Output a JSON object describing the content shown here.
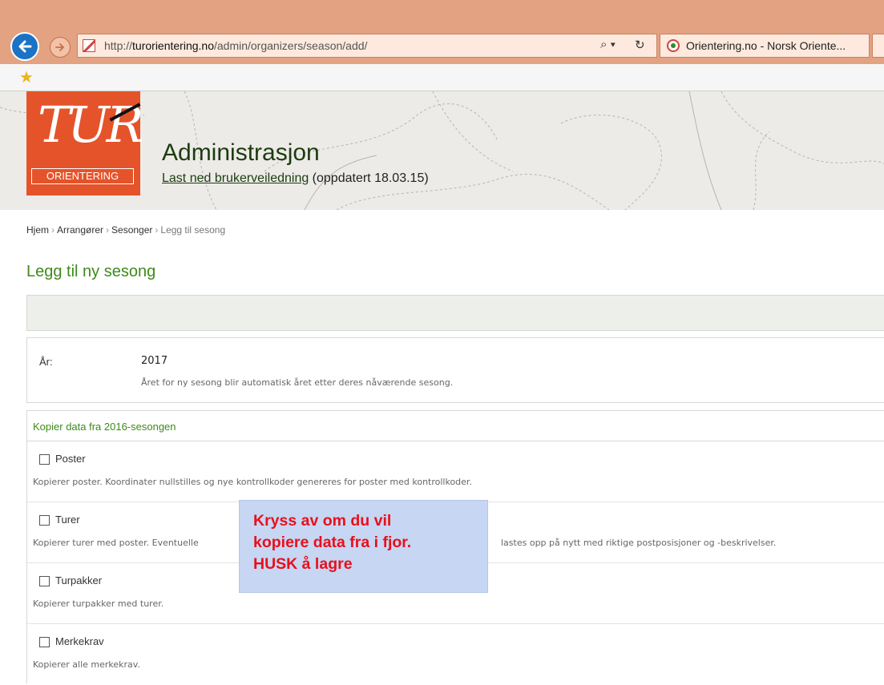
{
  "browser": {
    "url_prefix": "http://",
    "url_host": "turorientering.no",
    "url_path": "/admin/organizers/season/add/",
    "search_glyph": "⌕ ▾",
    "refresh_glyph": "↻",
    "tab_title": "Orientering.no - Norsk Oriente...",
    "icons": [
      "back-arrow-icon",
      "forward-arrow-icon",
      "site-favicon-icon",
      "search-icon",
      "refresh-icon",
      "favorites-star-icon"
    ]
  },
  "header": {
    "logo_main": "TUR",
    "logo_sub": "ORIENTERING",
    "title": "Administrasjon",
    "manual_link": "Last ned brukerveiledning",
    "manual_note": " (oppdatert 18.03.15)"
  },
  "breadcrumb": {
    "items": [
      "Hjem",
      "Arrangører",
      "Sesonger"
    ],
    "current": "Legg til sesong",
    "separator": "›"
  },
  "page": {
    "title": "Legg til ny sesong"
  },
  "year": {
    "label": "År:",
    "value": "2017",
    "help": "Året for ny sesong blir automatisk året etter deres nåværende sesong."
  },
  "copy_section": {
    "title": "Kopier data fra 2016-sesongen",
    "options": [
      {
        "label": "Poster",
        "checked": false,
        "help": "Kopierer poster. Koordinater nullstilles og nye kontrollkoder genereres for poster med kontrollkoder."
      },
      {
        "label": "Turer",
        "checked": false,
        "help_start": "Kopierer turer med poster. Eventuelle",
        "help_end": "lastes opp på nytt med riktige postposisjoner og -beskrivelser."
      },
      {
        "label": "Turpakker",
        "checked": false,
        "help": "Kopierer turpakker med turer."
      },
      {
        "label": "Merkekrav",
        "checked": false,
        "help": "Kopierer alle merkekrav."
      }
    ]
  },
  "callout": {
    "lines": [
      "Kryss av om du vil",
      "kopiere data fra i fjor.",
      "HUSK å lagre"
    ],
    "background": "#c6d6f3",
    "text_color": "#e8101b"
  },
  "colors": {
    "accent_green": "#3e8a1b",
    "logo_orange": "#e5532a",
    "titlebar": "#e3a282"
  }
}
